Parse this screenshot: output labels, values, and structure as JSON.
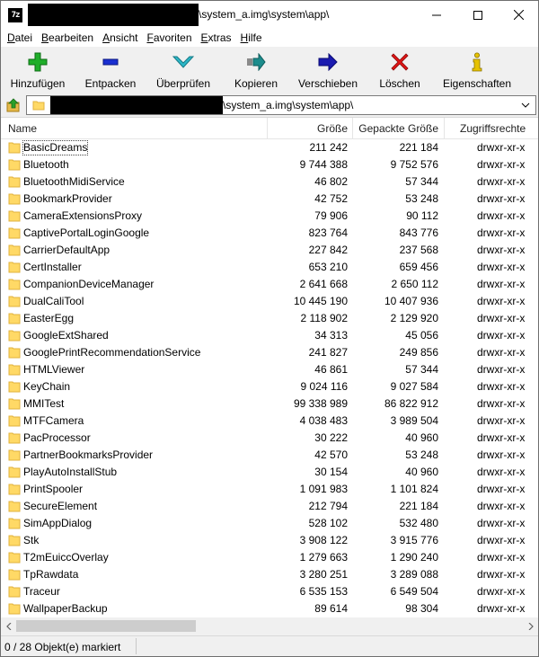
{
  "window": {
    "title_suffix": "\\system_a.img\\system\\app\\",
    "app_icon": "7z"
  },
  "menu": [
    {
      "accel": "D",
      "rest": "atei"
    },
    {
      "accel": "B",
      "rest": "earbeiten"
    },
    {
      "accel": "A",
      "rest": "nsicht"
    },
    {
      "accel": "F",
      "rest": "avoriten"
    },
    {
      "accel": "E",
      "rest": "xtras"
    },
    {
      "accel": "H",
      "rest": "ilfe"
    }
  ],
  "toolbar": [
    {
      "label": "Hinzufügen",
      "icon": "plus-icon",
      "color": "#1fae2a"
    },
    {
      "label": "Entpacken",
      "icon": "minus-icon",
      "color": "#1a2fd1"
    },
    {
      "label": "Überprüfen",
      "icon": "check-icon",
      "color": "#2bb8c8"
    },
    {
      "label": "Kopieren",
      "icon": "copy-arrow-icon",
      "color": "#1c8c8c"
    },
    {
      "label": "Verschieben",
      "icon": "move-arrow-icon",
      "color": "#1b1bb0"
    },
    {
      "label": "Löschen",
      "icon": "delete-x-icon",
      "color": "#e01515"
    },
    {
      "label": "Eigenschaften",
      "icon": "info-icon",
      "color": "#e6c200"
    }
  ],
  "address": {
    "path_suffix": "\\system_a.img\\system\\app\\"
  },
  "columns": {
    "name": "Name",
    "size": "Größe",
    "packed": "Gepackte Größe",
    "attr": "Zugriffsrechte"
  },
  "files": [
    {
      "name": "BasicDreams",
      "size": "211 242",
      "packed": "221 184",
      "attr": "drwxr-xr-x"
    },
    {
      "name": "Bluetooth",
      "size": "9 744 388",
      "packed": "9 752 576",
      "attr": "drwxr-xr-x"
    },
    {
      "name": "BluetoothMidiService",
      "size": "46 802",
      "packed": "57 344",
      "attr": "drwxr-xr-x"
    },
    {
      "name": "BookmarkProvider",
      "size": "42 752",
      "packed": "53 248",
      "attr": "drwxr-xr-x"
    },
    {
      "name": "CameraExtensionsProxy",
      "size": "79 906",
      "packed": "90 112",
      "attr": "drwxr-xr-x"
    },
    {
      "name": "CaptivePortalLoginGoogle",
      "size": "823 764",
      "packed": "843 776",
      "attr": "drwxr-xr-x"
    },
    {
      "name": "CarrierDefaultApp",
      "size": "227 842",
      "packed": "237 568",
      "attr": "drwxr-xr-x"
    },
    {
      "name": "CertInstaller",
      "size": "653 210",
      "packed": "659 456",
      "attr": "drwxr-xr-x"
    },
    {
      "name": "CompanionDeviceManager",
      "size": "2 641 668",
      "packed": "2 650 112",
      "attr": "drwxr-xr-x"
    },
    {
      "name": "DualCaliTool",
      "size": "10 445 190",
      "packed": "10 407 936",
      "attr": "drwxr-xr-x"
    },
    {
      "name": "EasterEgg",
      "size": "2 118 902",
      "packed": "2 129 920",
      "attr": "drwxr-xr-x"
    },
    {
      "name": "GoogleExtShared",
      "size": "34 313",
      "packed": "45 056",
      "attr": "drwxr-xr-x"
    },
    {
      "name": "GooglePrintRecommendationService",
      "size": "241 827",
      "packed": "249 856",
      "attr": "drwxr-xr-x"
    },
    {
      "name": "HTMLViewer",
      "size": "46 861",
      "packed": "57 344",
      "attr": "drwxr-xr-x"
    },
    {
      "name": "KeyChain",
      "size": "9 024 116",
      "packed": "9 027 584",
      "attr": "drwxr-xr-x"
    },
    {
      "name": "MMITest",
      "size": "99 338 989",
      "packed": "86 822 912",
      "attr": "drwxr-xr-x"
    },
    {
      "name": "MTFCamera",
      "size": "4 038 483",
      "packed": "3 989 504",
      "attr": "drwxr-xr-x"
    },
    {
      "name": "PacProcessor",
      "size": "30 222",
      "packed": "40 960",
      "attr": "drwxr-xr-x"
    },
    {
      "name": "PartnerBookmarksProvider",
      "size": "42 570",
      "packed": "53 248",
      "attr": "drwxr-xr-x"
    },
    {
      "name": "PlayAutoInstallStub",
      "size": "30 154",
      "packed": "40 960",
      "attr": "drwxr-xr-x"
    },
    {
      "name": "PrintSpooler",
      "size": "1 091 983",
      "packed": "1 101 824",
      "attr": "drwxr-xr-x"
    },
    {
      "name": "SecureElement",
      "size": "212 794",
      "packed": "221 184",
      "attr": "drwxr-xr-x"
    },
    {
      "name": "SimAppDialog",
      "size": "528 102",
      "packed": "532 480",
      "attr": "drwxr-xr-x"
    },
    {
      "name": "Stk",
      "size": "3 908 122",
      "packed": "3 915 776",
      "attr": "drwxr-xr-x"
    },
    {
      "name": "T2mEuiccOverlay",
      "size": "1 279 663",
      "packed": "1 290 240",
      "attr": "drwxr-xr-x"
    },
    {
      "name": "TpRawdata",
      "size": "3 280 251",
      "packed": "3 289 088",
      "attr": "drwxr-xr-x"
    },
    {
      "name": "Traceur",
      "size": "6 535 153",
      "packed": "6 549 504",
      "attr": "drwxr-xr-x"
    },
    {
      "name": "WallpaperBackup",
      "size": "89 614",
      "packed": "98 304",
      "attr": "drwxr-xr-x"
    }
  ],
  "status": {
    "text": "0 / 28 Objekt(e) markiert"
  },
  "colors": {
    "folder": "#ffd966",
    "folder_edge": "#e0b23c"
  }
}
